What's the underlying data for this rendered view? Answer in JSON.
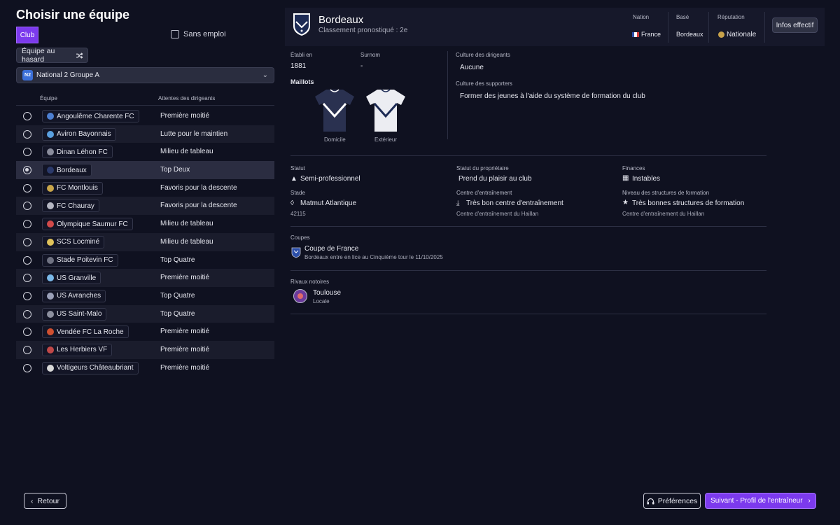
{
  "page": {
    "title": "Choisir une équipe"
  },
  "filters": {
    "tab_club": "Club",
    "unemployed_label": "Sans emploi",
    "random_team": "Équipe au hasard",
    "league_badge": "N2",
    "league": "National 2 Groupe A"
  },
  "table": {
    "col_team": "Équipe",
    "col_expectations": "Attentes des dirigeants",
    "rows": [
      {
        "team": "Angoulême Charente FC",
        "expectation": "Première moitié",
        "crest_color": "#4d7fd1"
      },
      {
        "team": "Aviron Bayonnais",
        "expectation": "Lutte pour le maintien",
        "crest_color": "#5aa0e0"
      },
      {
        "team": "Dinan Léhon FC",
        "expectation": "Milieu de tableau",
        "crest_color": "#8a8d9c"
      },
      {
        "team": "Bordeaux",
        "expectation": "Top Deux",
        "crest_color": "#2b3a6b"
      },
      {
        "team": "FC Montlouis",
        "expectation": "Favoris pour la descente",
        "crest_color": "#c9a64a"
      },
      {
        "team": "FC Chauray",
        "expectation": "Favoris pour la descente",
        "crest_color": "#b5b7c3"
      },
      {
        "team": "Olympique Saumur FC",
        "expectation": "Milieu de tableau",
        "crest_color": "#d24a4a"
      },
      {
        "team": "SCS Locminé",
        "expectation": "Milieu de tableau",
        "crest_color": "#e0c25a"
      },
      {
        "team": "Stade Poitevin FC",
        "expectation": "Top Quatre",
        "crest_color": "#6f7282"
      },
      {
        "team": "US Granville",
        "expectation": "Première moitié",
        "crest_color": "#7ab8e8"
      },
      {
        "team": "US Avranches",
        "expectation": "Top Quatre",
        "crest_color": "#9aa0b8"
      },
      {
        "team": "US Saint-Malo",
        "expectation": "Top Quatre",
        "crest_color": "#8c8f9e"
      },
      {
        "team": "Vendée FC La Roche",
        "expectation": "Première moitié",
        "crest_color": "#d05030"
      },
      {
        "team": "Les Herbiers VF",
        "expectation": "Première moitié",
        "crest_color": "#c04848"
      },
      {
        "team": "Voltigeurs Châteaubriant",
        "expectation": "Première moitié",
        "crest_color": "#d9d9d9"
      }
    ],
    "selected_index": 3
  },
  "club": {
    "name": "Bordeaux",
    "forecast": "Classement pronostiqué : 2e",
    "nation_label": "Nation",
    "nation": "France",
    "based_label": "Basé",
    "based": "Bordeaux",
    "reputation_label": "Réputation",
    "reputation": "Nationale",
    "squad_button": "Infos effectif",
    "founded_label": "Établi en",
    "founded": "1881",
    "nickname_label": "Surnom",
    "nickname": "-",
    "kits_label": "Maillots",
    "home_kit": "Domicile",
    "away_kit": "Extérieur",
    "board_culture_label": "Culture des dirigeants",
    "board_culture": "Aucune",
    "supporters_culture_label": "Culture des supporters",
    "supporters_culture": "Former des jeunes à l'aide du système de formation du club",
    "status_label": "Statut",
    "status": "Semi-professionnel",
    "owner_status_label": "Statut du propriétaire",
    "owner_status": "Prend du plaisir au club",
    "finances_label": "Finances",
    "finances": "Instables",
    "stadium_label": "Stade",
    "stadium": "Matmut Atlantique",
    "capacity": "42115",
    "training_label": "Centre d'entraînement",
    "training": "Très bon centre d'entraînement",
    "training_sub": "Centre d'entraînement du Haillan",
    "youth_label": "Niveau des structures de formation",
    "youth": "Très bonnes structures de formation",
    "youth_sub": "Centre d'entraînement du Haillan",
    "cups_label": "Coupes",
    "cup_name": "Coupe de France",
    "cup_detail": "Bordeaux entre en lice au Cinquième tour le 11/10/2025",
    "rivals_label": "Rivaux notoires",
    "rival_name": "Toulouse",
    "rival_type": "Locale"
  },
  "footer": {
    "back": "Retour",
    "preferences": "Préférences",
    "next": "Suivant - Profil de l'entraîneur"
  },
  "colors": {
    "accent": "#7c3aed",
    "background": "#0f1120"
  }
}
